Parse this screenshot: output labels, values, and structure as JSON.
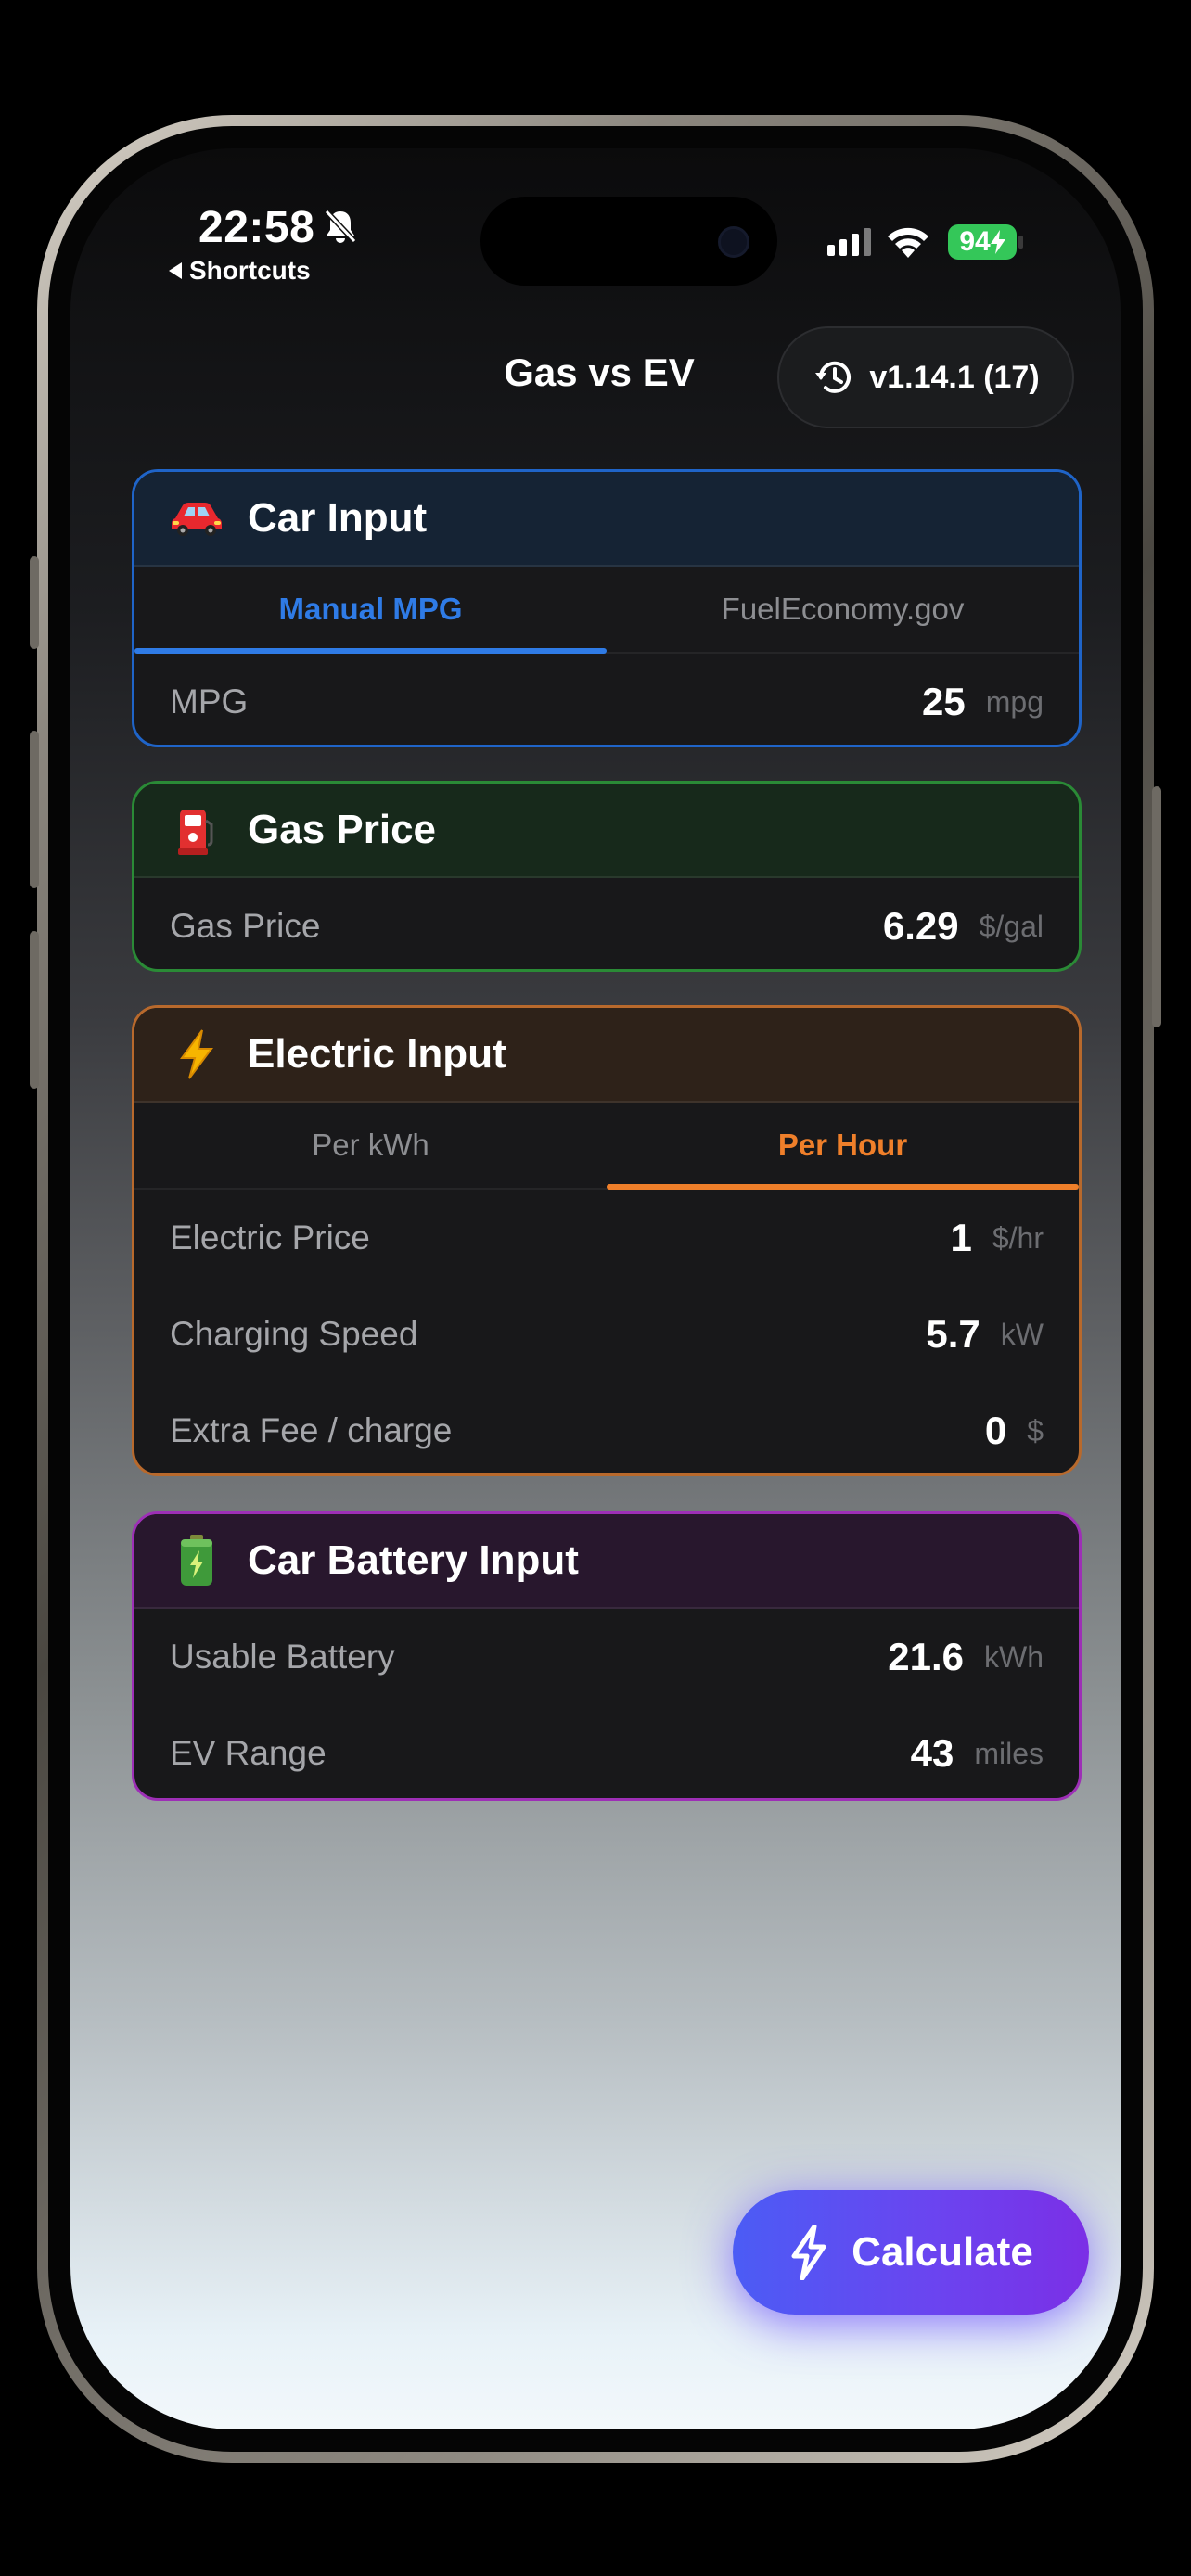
{
  "status_bar": {
    "time": "22:58",
    "back_label": "Shortcuts",
    "battery": "94"
  },
  "header": {
    "title": "Gas vs EV",
    "version": "v1.14.1 (17)"
  },
  "car_input": {
    "title": "Car Input",
    "emoji": "red-car-icon",
    "accent": "#1f64c8",
    "tabs": [
      {
        "label": "Manual MPG",
        "active": true
      },
      {
        "label": "FuelEconomy.gov",
        "active": false
      }
    ],
    "rows": [
      {
        "label": "MPG",
        "value": "25",
        "unit": "mpg"
      }
    ]
  },
  "gas_price": {
    "title": "Gas Price",
    "emoji": "fuel-pump-icon",
    "accent": "#2a8a36",
    "rows": [
      {
        "label": "Gas Price",
        "value": "6.29",
        "unit": "$/gal"
      }
    ]
  },
  "electric_input": {
    "title": "Electric Input",
    "emoji": "lightning-icon",
    "accent": "#e07b2e",
    "tabs": [
      {
        "label": "Per kWh",
        "active": false
      },
      {
        "label": "Per Hour",
        "active": true
      }
    ],
    "rows": [
      {
        "label": "Electric Price",
        "value": "1",
        "unit": "$/hr"
      },
      {
        "label": "Charging Speed",
        "value": "5.7",
        "unit": "kW"
      },
      {
        "label": "Extra Fee / charge",
        "value": "0",
        "unit": "$"
      }
    ]
  },
  "battery_input": {
    "title": "Car Battery Input",
    "emoji": "battery-icon",
    "accent": "#9d2fb6",
    "rows": [
      {
        "label": "Usable Battery",
        "value": "21.6",
        "unit": "kWh"
      },
      {
        "label": "EV Range",
        "value": "43",
        "unit": "miles"
      }
    ]
  },
  "calculate_label": "Calculate"
}
